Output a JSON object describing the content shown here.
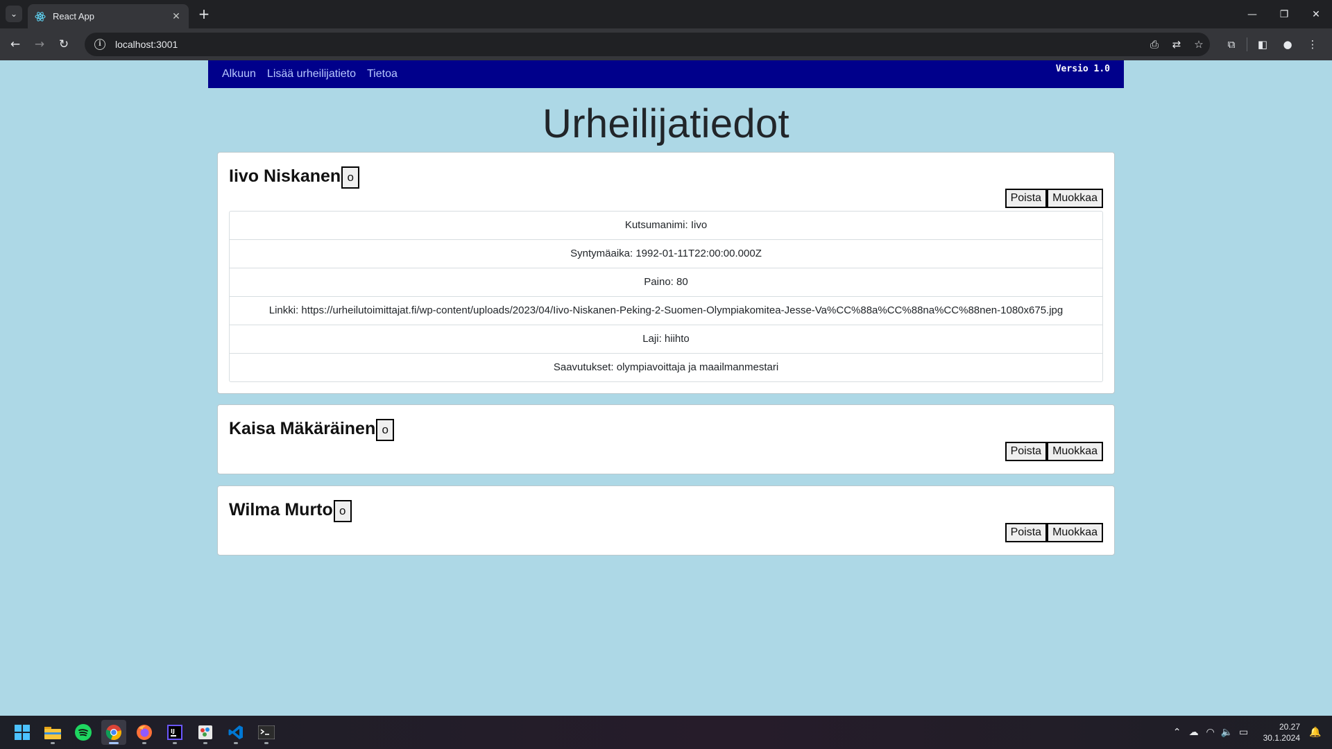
{
  "browser": {
    "tab_title": "React App",
    "url": "localhost:3001"
  },
  "nav": {
    "links": [
      "Alkuun",
      "Lisää urheilijatieto",
      "Tietoa"
    ],
    "version": "Versio 1.0"
  },
  "page": {
    "title": "Urheilijatiedot"
  },
  "athletes": [
    {
      "name": "Iivo Niskanen",
      "toggle": "o",
      "expanded": true,
      "delete_label": "Poista",
      "edit_label": "Muokkaa",
      "details": [
        "Kutsumanimi: Iivo",
        "Syntymäaika: 1992-01-11T22:00:00.000Z",
        "Paino: 80",
        "Linkki: https://urheilutoimittajat.fi/wp-content/uploads/2023/04/Iivo-Niskanen-Peking-2-Suomen-Olympiakomitea-Jesse-Va%CC%88a%CC%88na%CC%88nen-1080x675.jpg",
        "Laji: hiihto",
        "Saavutukset: olympiavoittaja ja maailmanmestari"
      ]
    },
    {
      "name": "Kaisa Mäkäräinen",
      "toggle": "o",
      "expanded": false,
      "delete_label": "Poista",
      "edit_label": "Muokkaa"
    },
    {
      "name": "Wilma Murto",
      "toggle": "o",
      "expanded": false,
      "delete_label": "Poista",
      "edit_label": "Muokkaa"
    }
  ],
  "taskbar": {
    "apps": [
      "start-icon",
      "file-explorer-icon",
      "spotify-icon",
      "chrome-icon",
      "firefox-icon",
      "intellij-icon",
      "paint-icon",
      "vscode-icon",
      "terminal-icon"
    ],
    "time": "20.27",
    "date": "30.1.2024"
  }
}
